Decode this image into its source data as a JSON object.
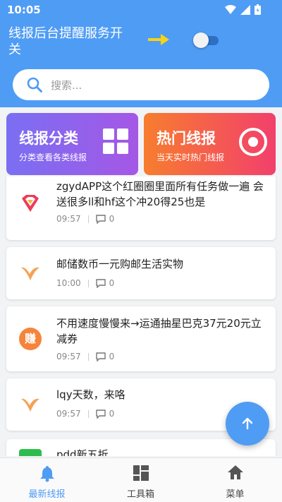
{
  "status_bar": {
    "time": "10:05"
  },
  "header": {
    "switch_label": "线报后台提醒服务开关",
    "switch_on": false
  },
  "search": {
    "placeholder": "搜索..."
  },
  "cards": [
    {
      "title": "线报分类",
      "subtitle": "分类查看各类线报",
      "icon": "grid-icon",
      "color_from": "#7a6ff2",
      "color_to": "#a557e6"
    },
    {
      "title": "热门线报",
      "subtitle": "当天实时热门线报",
      "icon": "target-icon",
      "color_from": "#f77d2f",
      "color_to": "#f2406c"
    }
  ],
  "feed": [
    {
      "title": "zgydAPP这个红圈圈里面所有任务做一遍 会送很多ll和hf这个冲20得25也是",
      "time": "09:57",
      "comments": "0",
      "logo": "red-diamond-logo"
    },
    {
      "title": "邮储数币一元购邮生活实物",
      "time": "10:00",
      "comments": "0",
      "logo": "orange-v-logo"
    },
    {
      "title": "不用速度慢慢来→运通抽星巴克37元20元立减券",
      "time": "09:57",
      "comments": "0",
      "logo": "earn-logo",
      "logo_text": "赚"
    },
    {
      "title": "lqy天数，来咯",
      "time": "09:57",
      "comments": "0",
      "logo": "orange-v-logo"
    },
    {
      "title": "pdd新五折",
      "time": "",
      "comments": "",
      "logo": "green-logo"
    }
  ],
  "tabbar": [
    {
      "label": "最新线报",
      "icon": "bell-icon",
      "active": true
    },
    {
      "label": "工具箱",
      "icon": "dashboard-icon",
      "active": false
    },
    {
      "label": "菜单",
      "icon": "home-icon",
      "active": false
    }
  ],
  "colors": {
    "primary": "#4f9cf5",
    "arrow": "#f5d316"
  }
}
